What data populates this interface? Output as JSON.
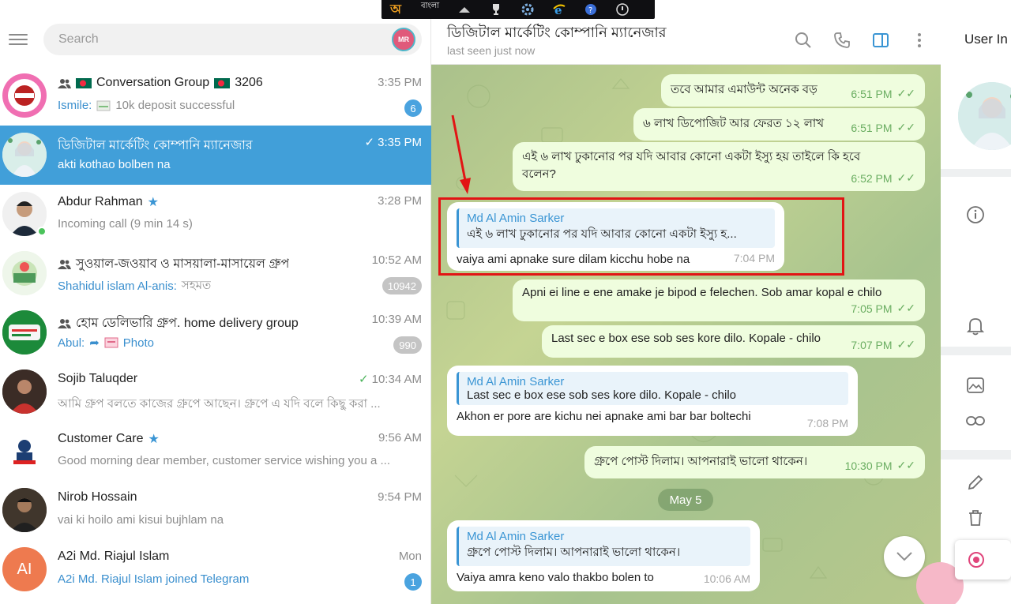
{
  "system_bar": {
    "language": "বাংলা",
    "logo": "অ"
  },
  "search": {
    "placeholder": "Search",
    "avatar_initials": "MR"
  },
  "chats": [
    {
      "name": "Conversation Group",
      "name_suffix": "3206",
      "is_group": true,
      "time": "3:35 PM",
      "sender": "Ismile:",
      "preview": "10k deposit successful",
      "badge": "6",
      "badge_muted": false
    },
    {
      "name": "ডিজিটাল মার্কেটিং কোম্পানি ম্যানেজার",
      "time": "3:35 PM",
      "preview": "akti kothao bolben na",
      "active": true,
      "read": true
    },
    {
      "name": "Abdur Rahman",
      "star": true,
      "time": "3:28 PM",
      "preview": "Incoming call (9 min 14 s)",
      "online": true
    },
    {
      "name": "সুওয়াল-জওয়াব ও মাসয়ালা-মাসায়েল গ্রুপ",
      "is_group": true,
      "time": "10:52 AM",
      "sender": "Shahidul islam Al-anis:",
      "preview": "সহমত",
      "badge": "10942",
      "badge_muted": true
    },
    {
      "name": "হোম ডেলিভারি গ্রুপ. home delivery group",
      "is_group": true,
      "time": "10:39 AM",
      "sender": "Abul:",
      "preview": "Photo",
      "badge": "990",
      "badge_muted": true
    },
    {
      "name": "Sojib Taluqder",
      "time": "10:34 AM",
      "read": true,
      "preview": "আমি গ্রুপ বলতে কাজের গ্রুপে আছেন। গ্রুপে এ যদি বলে কিছু করা ..."
    },
    {
      "name": "Customer Care",
      "star": true,
      "time": "9:56 AM",
      "preview": "Good morning dear member, customer service wishing you a ..."
    },
    {
      "name": "Nirob Hossain",
      "time": "9:54 PM",
      "preview": "vai ki  hoilo ami kisui bujhlam na"
    },
    {
      "name": "A2i Md. Riajul Islam",
      "avatar_text": "AI",
      "time": "Mon",
      "preview": "A2i Md. Riajul Islam joined Telegram",
      "preview_link": true,
      "badge": "1",
      "badge_muted": false
    }
  ],
  "header": {
    "title": "ডিজিটাল মার্কেটিং কোম্পানি ম্যানেজার",
    "status": "last seen just now"
  },
  "messages": [
    {
      "text": "তবে আমার এমাউন্ট অনেক বড়",
      "time": "6:51 PM"
    },
    {
      "text": "৬ লাখ ডিপোজিট আর ফেরত ১২ লাখ",
      "time": "6:51 PM"
    },
    {
      "text": "এই ৬ লাখ ঢুকানোর পর যদি আবার কোনো একটা ইস্যু হয় তাইলে কি হবে বলেন?",
      "time": "6:52 PM"
    },
    {
      "quote_name": "Md Al Amin Sarker",
      "quote_text": "এই ৬ লাখ ঢুকানোর পর যদি আবার কোনো একটা ইস্যু হ...",
      "text": "vaiya ami apnake  sure  dilam kicchu hobe na",
      "time": "7:04 PM"
    },
    {
      "text": "Apni ei line e ene amake je bipod e felechen. Sob amar kopal e chilo",
      "time": "7:05 PM"
    },
    {
      "text": "Last sec e box ese sob ses kore dilo. Kopale - chilo",
      "time": "7:07 PM"
    },
    {
      "quote_name": "Md Al Amin Sarker",
      "quote_text": "Last sec e box ese sob ses kore dilo. Kopale - chilo",
      "text": "Akhon er pore are kichu  nei apnake ami  bar bar  boltechi",
      "time": "7:08 PM"
    },
    {
      "text": "গ্রুপে পোস্ট দিলাম। আপনারাই ভালো থাকেন।",
      "time": "10:30 PM"
    },
    {
      "quote_name": "Md Al Amin Sarker",
      "quote_text": "গ্রুপে পোস্ট দিলাম। আপনারাই ভালো থাকেন।",
      "text": "Vaiya  amra  keno  valo thakbo  bolen to",
      "time": "10:06 AM"
    }
  ],
  "date_separator": "May 5",
  "right_panel": {
    "title": "User In"
  },
  "colors": {
    "active_chat": "#419fd9",
    "outgoing_bubble": "#effdde",
    "incoming_bubble": "#ffffff",
    "highlight": "#e21414",
    "link": "#3a8fce"
  }
}
